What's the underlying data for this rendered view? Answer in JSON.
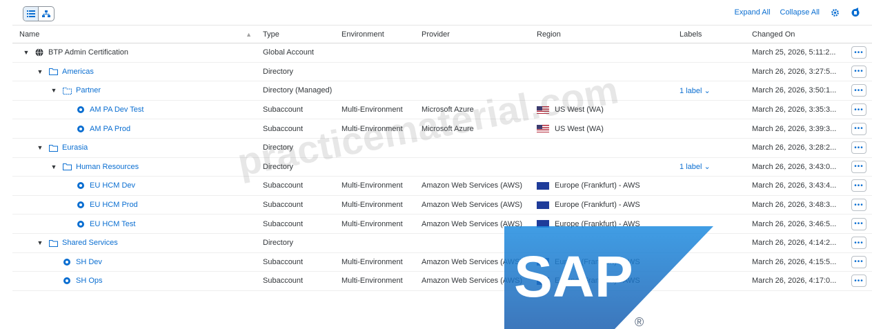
{
  "toolbar": {
    "expand_all": "Expand All",
    "collapse_all": "Collapse All"
  },
  "columns": {
    "name": "Name",
    "type": "Type",
    "environment": "Environment",
    "provider": "Provider",
    "region": "Region",
    "labels": "Labels",
    "changed_on": "Changed On"
  },
  "rows": [
    {
      "name": "BTP Admin Certification",
      "type": "Global Account",
      "environment": "",
      "provider": "",
      "region": "",
      "labels": "",
      "changed_on": "March 25, 2026, 5:11:2..."
    },
    {
      "name": "Americas",
      "type": "Directory",
      "environment": "",
      "provider": "",
      "region": "",
      "labels": "",
      "changed_on": "March 26, 2026, 3:27:5..."
    },
    {
      "name": "Partner",
      "type": "Directory (Managed)",
      "environment": "",
      "provider": "",
      "region": "",
      "labels": "1 label",
      "changed_on": "March 26, 2026, 3:50:1..."
    },
    {
      "name": "AM PA Dev Test",
      "type": "Subaccount",
      "environment": "Multi-Environment",
      "provider": "Microsoft Azure",
      "region": "US West (WA)",
      "labels": "",
      "changed_on": "March 26, 2026, 3:35:3..."
    },
    {
      "name": "AM PA Prod",
      "type": "Subaccount",
      "environment": "Multi-Environment",
      "provider": "Microsoft Azure",
      "region": "US West (WA)",
      "labels": "",
      "changed_on": "March 26, 2026, 3:39:3..."
    },
    {
      "name": "Eurasia",
      "type": "Directory",
      "environment": "",
      "provider": "",
      "region": "",
      "labels": "",
      "changed_on": "March 26, 2026, 3:28:2..."
    },
    {
      "name": "Human Resources",
      "type": "Directory",
      "environment": "",
      "provider": "",
      "region": "",
      "labels": "1 label",
      "changed_on": "March 26, 2026, 3:43:0..."
    },
    {
      "name": "EU HCM Dev",
      "type": "Subaccount",
      "environment": "Multi-Environment",
      "provider": "Amazon Web Services (AWS)",
      "region": "Europe (Frankfurt) - AWS",
      "labels": "",
      "changed_on": "March 26, 2026, 3:43:4..."
    },
    {
      "name": "EU HCM Prod",
      "type": "Subaccount",
      "environment": "Multi-Environment",
      "provider": "Amazon Web Services (AWS)",
      "region": "Europe (Frankfurt) - AWS",
      "labels": "",
      "changed_on": "March 26, 2026, 3:48:3..."
    },
    {
      "name": "EU HCM Test",
      "type": "Subaccount",
      "environment": "Multi-Environment",
      "provider": "Amazon Web Services (AWS)",
      "region": "Europe (Frankfurt) - AWS",
      "labels": "",
      "changed_on": "March 26, 2026, 3:46:5..."
    },
    {
      "name": "Shared Services",
      "type": "Directory",
      "environment": "",
      "provider": "",
      "region": "",
      "labels": "",
      "changed_on": "March 26, 2026, 4:14:2..."
    },
    {
      "name": "SH Dev",
      "type": "Subaccount",
      "environment": "Multi-Environment",
      "provider": "Amazon Web Services (AWS)",
      "region": "Europe (Frankfurt) - AWS",
      "labels": "",
      "changed_on": "March 26, 2026, 4:15:5..."
    },
    {
      "name": "SH Ops",
      "type": "Subaccount",
      "environment": "Multi-Environment",
      "provider": "Amazon Web Services (AWS)",
      "region": "Europe (Frankfurt) - AWS",
      "labels": "",
      "changed_on": "March 26, 2026, 4:17:0..."
    }
  ],
  "overlay": {
    "watermark": "practicematerial.com",
    "logo_text": "SAP",
    "logo_mark": "®"
  },
  "colors": {
    "accent": "#0a6ed1",
    "logo_blue": "#1a73c8"
  }
}
